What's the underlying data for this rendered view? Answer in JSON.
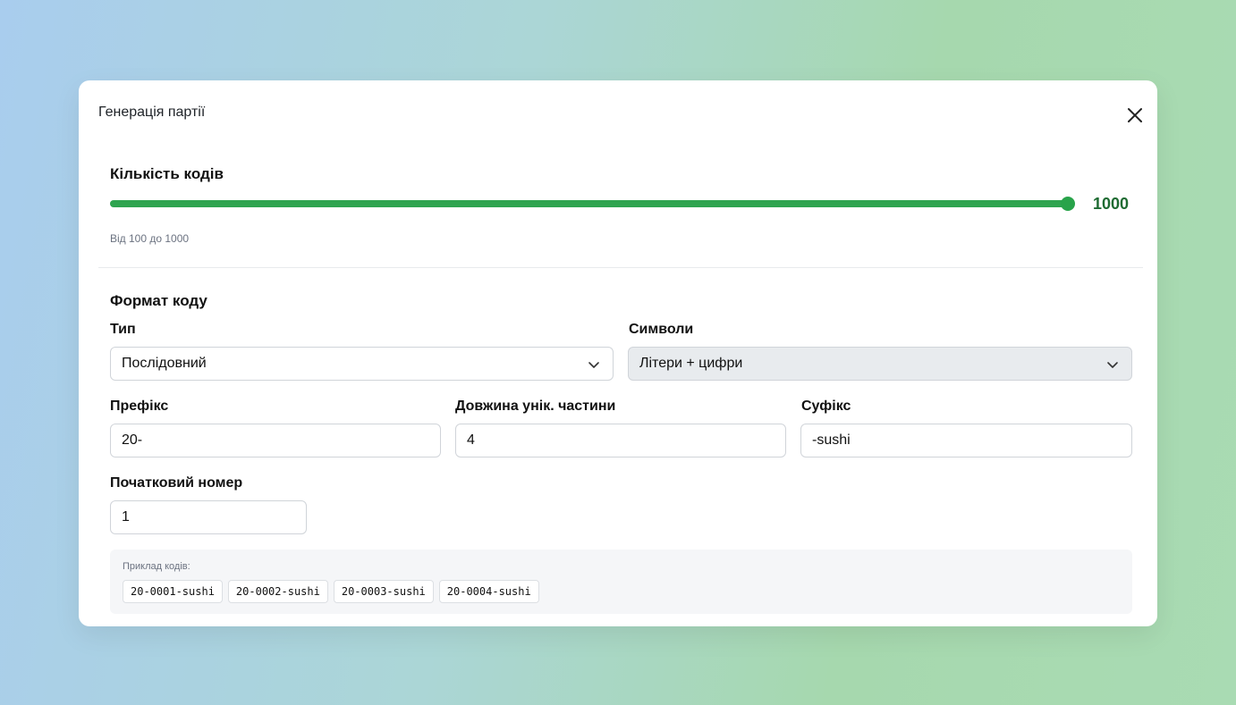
{
  "modal": {
    "title": "Генерація партії",
    "close_icon": "close-icon"
  },
  "quantity": {
    "section_title": "Кількість кодів",
    "value": 1000,
    "value_label": "1000",
    "min": 100,
    "max": 1000,
    "hint": "Від 100 до 1000",
    "accent_color": "#2ea44f"
  },
  "format": {
    "section_title": "Формат коду",
    "type_label": "Тип",
    "type_value": "Послідовний",
    "symbols_label": "Символи",
    "symbols_value": "Літери + цифри",
    "prefix_label": "Префікс",
    "prefix_value": "20-",
    "length_label": "Довжина унік. частини",
    "length_value": "4",
    "suffix_label": "Суфікс",
    "suffix_value": "-sushi",
    "start_label": "Початковий номер",
    "start_value": "1"
  },
  "examples": {
    "label": "Приклад кодів:",
    "codes": [
      "20-0001-sushi",
      "20-0002-sushi",
      "20-0003-sushi",
      "20-0004-sushi"
    ]
  }
}
